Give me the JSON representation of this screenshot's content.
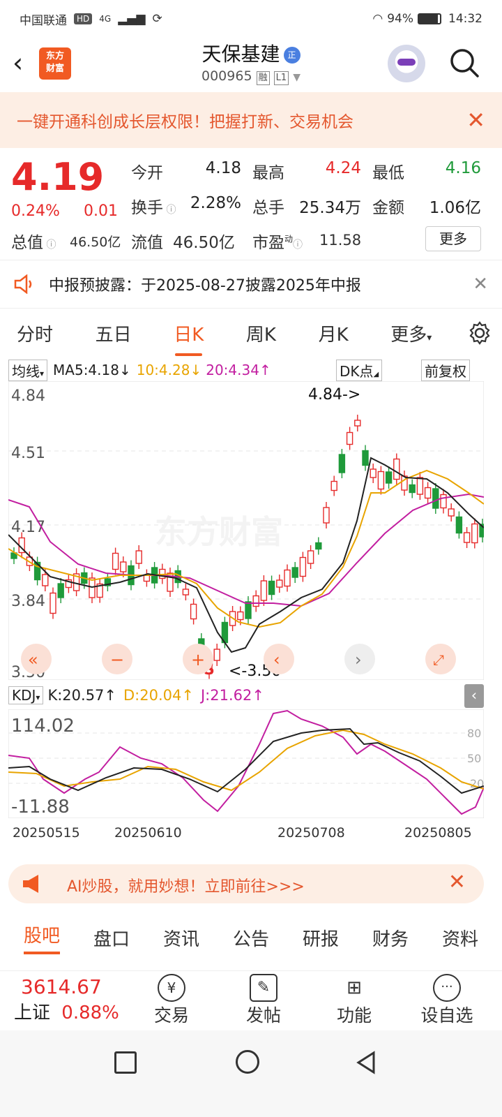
{
  "status": {
    "carrier": "中国联通",
    "hd": "HD",
    "net": "4G",
    "battery": "94%",
    "time": "14:32"
  },
  "header": {
    "logo": "东方财富",
    "name": "天保基建",
    "zheng": "正",
    "code": "000965",
    "badge1": "融",
    "badge2": "L1"
  },
  "banner": {
    "text": "一键开通科创成长层权限！把握打新、交易机会",
    "close": "✕"
  },
  "quote": {
    "price": "4.19",
    "chg_pct": "0.24%",
    "chg_val": "0.01",
    "open_label": "今开",
    "open": "4.18",
    "high_label": "最高",
    "high": "4.24",
    "low_label": "最低",
    "low": "4.16",
    "turnover_label": "换手",
    "turnover": "2.28%",
    "vol_label": "总手",
    "vol": "25.34万",
    "amt_label": "金额",
    "amt": "1.06亿",
    "mktcap_label": "总值",
    "mktcap": "46.50亿",
    "float_label": "流值",
    "float": "46.50亿",
    "pe_label": "市盈",
    "pe_sup": "动",
    "pe": "11.58",
    "more": "更多"
  },
  "notice": {
    "text": "中报预披露：于2025-08-27披露2025年中报",
    "close": "✕"
  },
  "tabs": [
    "分时",
    "五日",
    "日K",
    "周K",
    "月K",
    "更多"
  ],
  "ma": {
    "selector": "均线",
    "ma5": "MA5:4.18↓",
    "ma10": "10:4.28↓",
    "ma20": "20:4.34↑",
    "dk": "DK点",
    "adj": "前复权"
  },
  "chart": {
    "ticks": [
      "4.84",
      "4.51",
      "4.17",
      "3.84",
      "3.50"
    ],
    "max_label": "4.84->",
    "min_label": "<-3.50",
    "s_mark": "S",
    "watermark": "东方财富"
  },
  "kdj": {
    "selector": "KDJ",
    "k": "K:20.57↑",
    "d": "D:20.04↑",
    "j": "J:21.62↑",
    "top": "114.02",
    "bottom": "-11.88",
    "levels": [
      "80",
      "50",
      "20"
    ]
  },
  "dates": [
    "20250515",
    "20250610",
    "20250708",
    "20250805"
  ],
  "ai": {
    "text": "AI炒股，就用妙想！立即前往>>>",
    "close": "✕"
  },
  "bottom_tabs": [
    "股吧",
    "盘口",
    "资讯",
    "公告",
    "研报",
    "财务",
    "资料"
  ],
  "footer": {
    "index_val": "3614.67",
    "index_name": "上证",
    "index_pct": "0.88%",
    "trade": "交易",
    "post": "发帖",
    "func": "功能",
    "fav": "设自选"
  },
  "colors": {
    "up": "#e62a2a",
    "down": "#1f9a3a",
    "accent": "#f15a22",
    "ma5": "#222222",
    "ma10": "#e8a400",
    "ma20": "#c21ea0"
  }
}
